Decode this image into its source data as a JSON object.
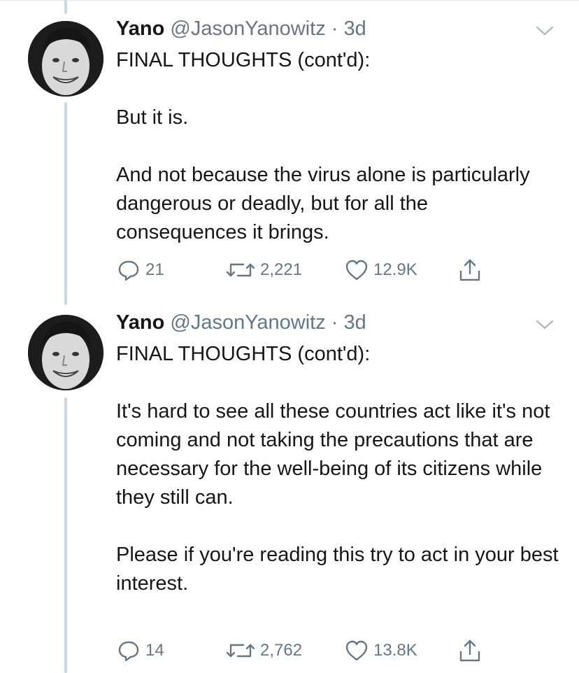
{
  "tweets": [
    {
      "author": {
        "name": "Yano",
        "handle": "@JasonYanowitz",
        "time": "3d"
      },
      "separator": "·",
      "lines": [
        "FINAL THOUGHTS (cont'd):",
        "But it is.",
        "And not because the virus alone is particularly dangerous or deadly, but for all the consequences it brings."
      ],
      "actions": {
        "replies": "21",
        "retweets": "2,221",
        "likes": "12.9K"
      }
    },
    {
      "author": {
        "name": "Yano",
        "handle": "@JasonYanowitz",
        "time": "3d"
      },
      "separator": "·",
      "lines": [
        "FINAL THOUGHTS (cont'd):",
        "It's hard to see all these countries act like it's not coming and not taking the precautions that are necessary for the well-being of its citizens while they still can.",
        "Please if you're reading this try to act in your best interest."
      ],
      "actions": {
        "replies": "14",
        "retweets": "2,762",
        "likes": "13.8K"
      }
    }
  ],
  "icons": {
    "reply": "reply-icon",
    "retweet": "retweet-icon",
    "like": "heart-icon",
    "share": "share-icon",
    "menu": "chevron-down-icon",
    "avatar": "avatar"
  },
  "colors": {
    "text": "#14171a",
    "secondary": "#657786",
    "thread_line": "#ccd6dd"
  }
}
